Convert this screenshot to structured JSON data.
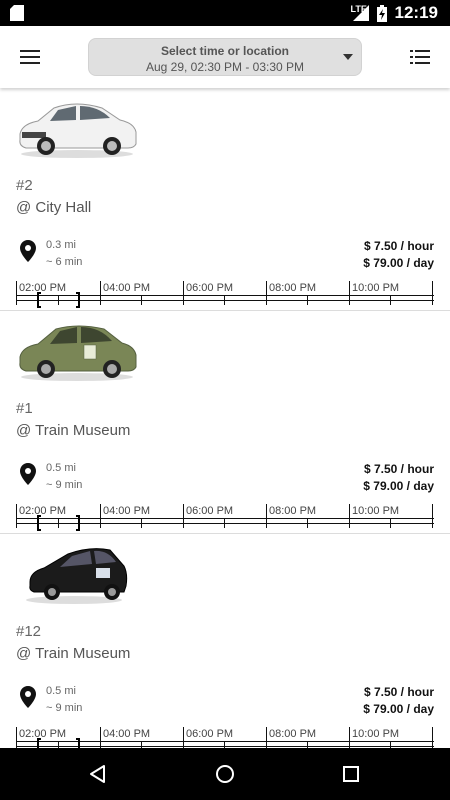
{
  "status_bar": {
    "time": "12:19",
    "network": "LTE"
  },
  "header": {
    "selector_title": "Select time or location",
    "selector_subtitle": "Aug 29, 02:30 PM - 03:30 PM"
  },
  "timeline_labels": [
    "02:00 PM",
    "04:00 PM",
    "06:00 PM",
    "08:00 PM",
    "10:00 PM"
  ],
  "cars": [
    {
      "id": "#2",
      "location": "@ City Hall",
      "distance": "0.3 mi",
      "walk_time": "~ 6 min",
      "price_hour": "$ 7.50 / hour",
      "price_day": "$ 79.00 / day",
      "color": "#f2f2f2"
    },
    {
      "id": "#1",
      "location": "@ Train Museum",
      "distance": "0.5 mi",
      "walk_time": "~ 9 min",
      "price_hour": "$ 7.50 / hour",
      "price_day": "$ 79.00 / day",
      "color": "#7a8656"
    },
    {
      "id": "#12",
      "location": "@ Train Museum",
      "distance": "0.5 mi",
      "walk_time": "~ 9 min",
      "price_hour": "$ 7.50 / hour",
      "price_day": "$ 79.00 / day",
      "color": "#1b1b1b"
    }
  ]
}
